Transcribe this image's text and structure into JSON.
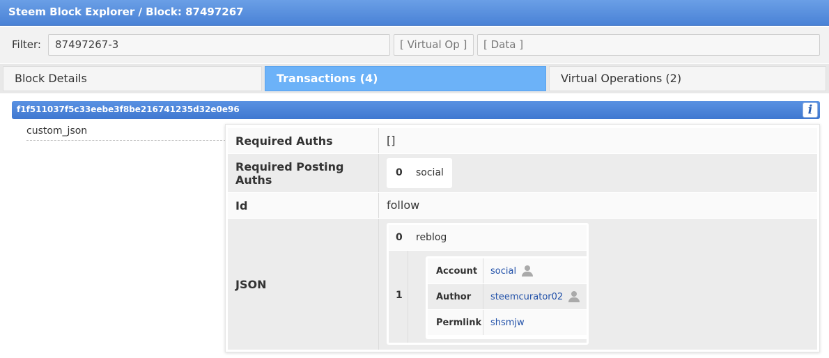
{
  "header": {
    "title": "Steem Block Explorer / Block: 87497267"
  },
  "filter": {
    "label": "Filter:",
    "value": "87497267-3",
    "virtual_op_label": "[ Virtual Op ]",
    "data_label": "[ Data ]"
  },
  "tabs": [
    {
      "label": "Block Details",
      "active": false
    },
    {
      "label": "Transactions (4)",
      "active": true
    },
    {
      "label": "Virtual Operations (2)",
      "active": false
    }
  ],
  "transaction": {
    "hash": "f1f511037f5c33eebe3f8be216741235d32e0e96",
    "info_icon": "info-icon",
    "op_type": "custom_json",
    "fields": {
      "required_auths_label": "Required Auths",
      "required_auths_value": "[]",
      "required_posting_auths_label": "Required Posting Auths",
      "required_posting_auths": [
        {
          "index": "0",
          "value": "social"
        }
      ],
      "id_label": "Id",
      "id_value": "follow",
      "json_label": "JSON",
      "json": {
        "item0_index": "0",
        "item0_value": "reblog",
        "item1_index": "1",
        "account_label": "Account",
        "account_value": "social",
        "author_label": "Author",
        "author_value": "steemcurator02",
        "permlink_label": "Permlink",
        "permlink_value": "shsmjw"
      }
    }
  },
  "colors": {
    "header": "#4a82d6",
    "active_tab": "#6cb2f8",
    "link": "#1f4fa8"
  }
}
